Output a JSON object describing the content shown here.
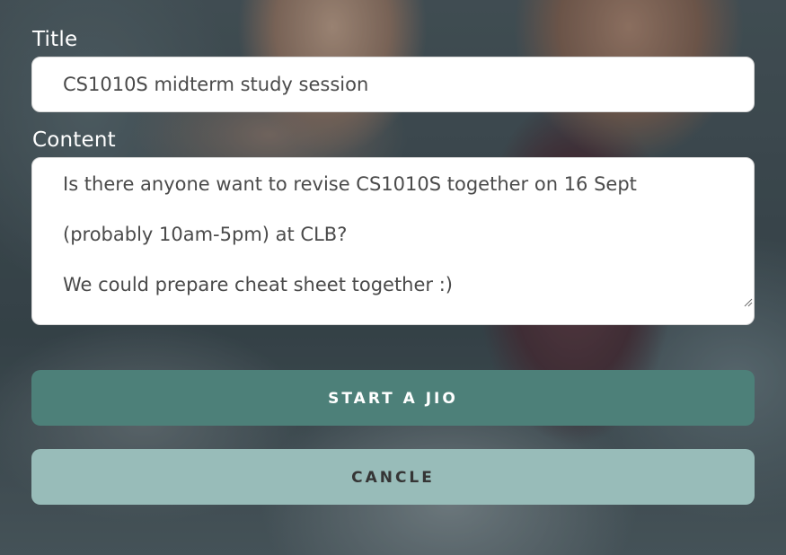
{
  "form": {
    "title_label": "Title",
    "title_value": "CS1010S midterm study session",
    "content_label": "Content",
    "content_lines": [
      "Is there anyone want to revise CS1010S together on 16 Sept",
      "(probably 10am-5pm) at CLB?",
      "We could prepare cheat sheet together :)"
    ]
  },
  "buttons": {
    "start_label": "START A JIO",
    "cancel_label": "CANCLE"
  },
  "colors": {
    "primary_button": "#4d8079",
    "secondary_button": "#98bcb9",
    "label_text": "#ffffff",
    "input_text": "#4a4a4a"
  },
  "icons": {
    "resize_grip": "resize-grip-icon"
  }
}
